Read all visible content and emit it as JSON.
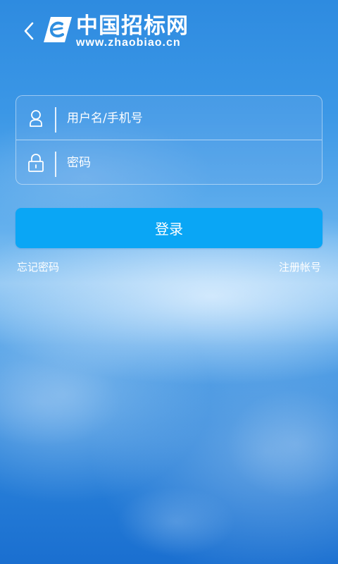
{
  "header": {
    "logo_title": "中国招标网",
    "logo_url": "www.zhaobiao.cn"
  },
  "form": {
    "username_placeholder": "用户名/手机号",
    "password_placeholder": "密码"
  },
  "login_label": "登录",
  "forgot_password": "忘记密码",
  "register": "注册帐号",
  "colors": {
    "login_button": "#0aa6f5",
    "text": "#ffffff",
    "background": "#2f8fe0"
  }
}
